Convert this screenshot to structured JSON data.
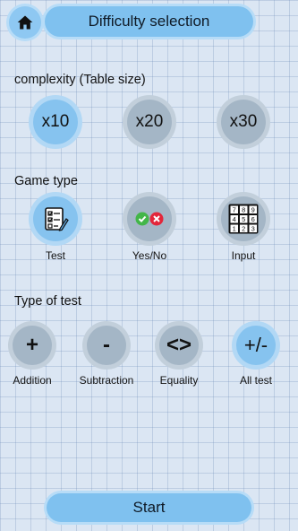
{
  "header": {
    "home_icon": "home-icon",
    "title": "Difficulty selection"
  },
  "complexity": {
    "title": "complexity (Table size)",
    "options": [
      {
        "label": "x10",
        "selected": true
      },
      {
        "label": "x20",
        "selected": false
      },
      {
        "label": "x30",
        "selected": false
      }
    ]
  },
  "game_type": {
    "title": "Game type",
    "options": [
      {
        "label": "Test",
        "icon": "test-checklist-icon",
        "selected": true
      },
      {
        "label": "Yes/No",
        "icon": "yes-no-icon",
        "selected": false
      },
      {
        "label": "Input",
        "icon": "number-keypad-icon",
        "selected": false
      }
    ],
    "keypad_digits": [
      "7",
      "8",
      "9",
      "4",
      "5",
      "6",
      "1",
      "2",
      "3"
    ]
  },
  "test_type": {
    "title": "Type of test",
    "options": [
      {
        "label": "Addition",
        "symbol": "+",
        "selected": false
      },
      {
        "label": "Subtraction",
        "symbol": "-",
        "selected": false
      },
      {
        "label": "Equality",
        "symbol": "<>",
        "selected": false
      },
      {
        "label": "All test",
        "symbol": "+/-",
        "selected": true
      }
    ]
  },
  "footer": {
    "start_label": "Start"
  },
  "colors": {
    "background": "#dbe6f3",
    "selected": "#86c3ef",
    "unselected": "#a4b6c6",
    "pill": "#7fc1ef",
    "yes_green": "#43b649",
    "no_red": "#e3263a"
  }
}
